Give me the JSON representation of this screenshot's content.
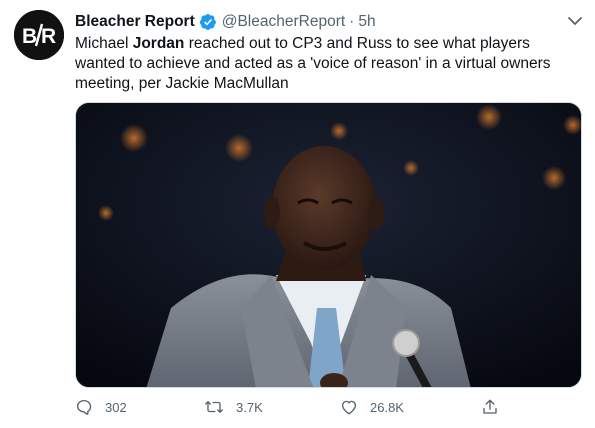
{
  "tweet": {
    "account": {
      "display_name": "Bleacher Report",
      "handle": "@BleacherReport",
      "separator": "·",
      "timestamp": "5h",
      "avatar_text": "B/R",
      "verified": true
    },
    "text": {
      "part1": "Michael ",
      "highlight": "Jordan",
      "part2": " reached out to CP3 and Russ to see what players wanted to achieve and acted as a 'voice of reason' in a virtual owners meeting, per Jackie MacMullan"
    },
    "media": {
      "type": "photo"
    },
    "actions": {
      "reply_count": "302",
      "retweet_count": "3.7K",
      "like_count": "26.8K"
    }
  },
  "colors": {
    "text_primary": "#0f1419",
    "text_secondary": "#536471",
    "verified_blue": "#1d9bf0",
    "avatar_bg": "#111111"
  },
  "icons": [
    "br-logo-icon",
    "verified-badge-icon",
    "chevron-down-icon",
    "reply-icon",
    "retweet-icon",
    "like-icon",
    "share-icon"
  ]
}
